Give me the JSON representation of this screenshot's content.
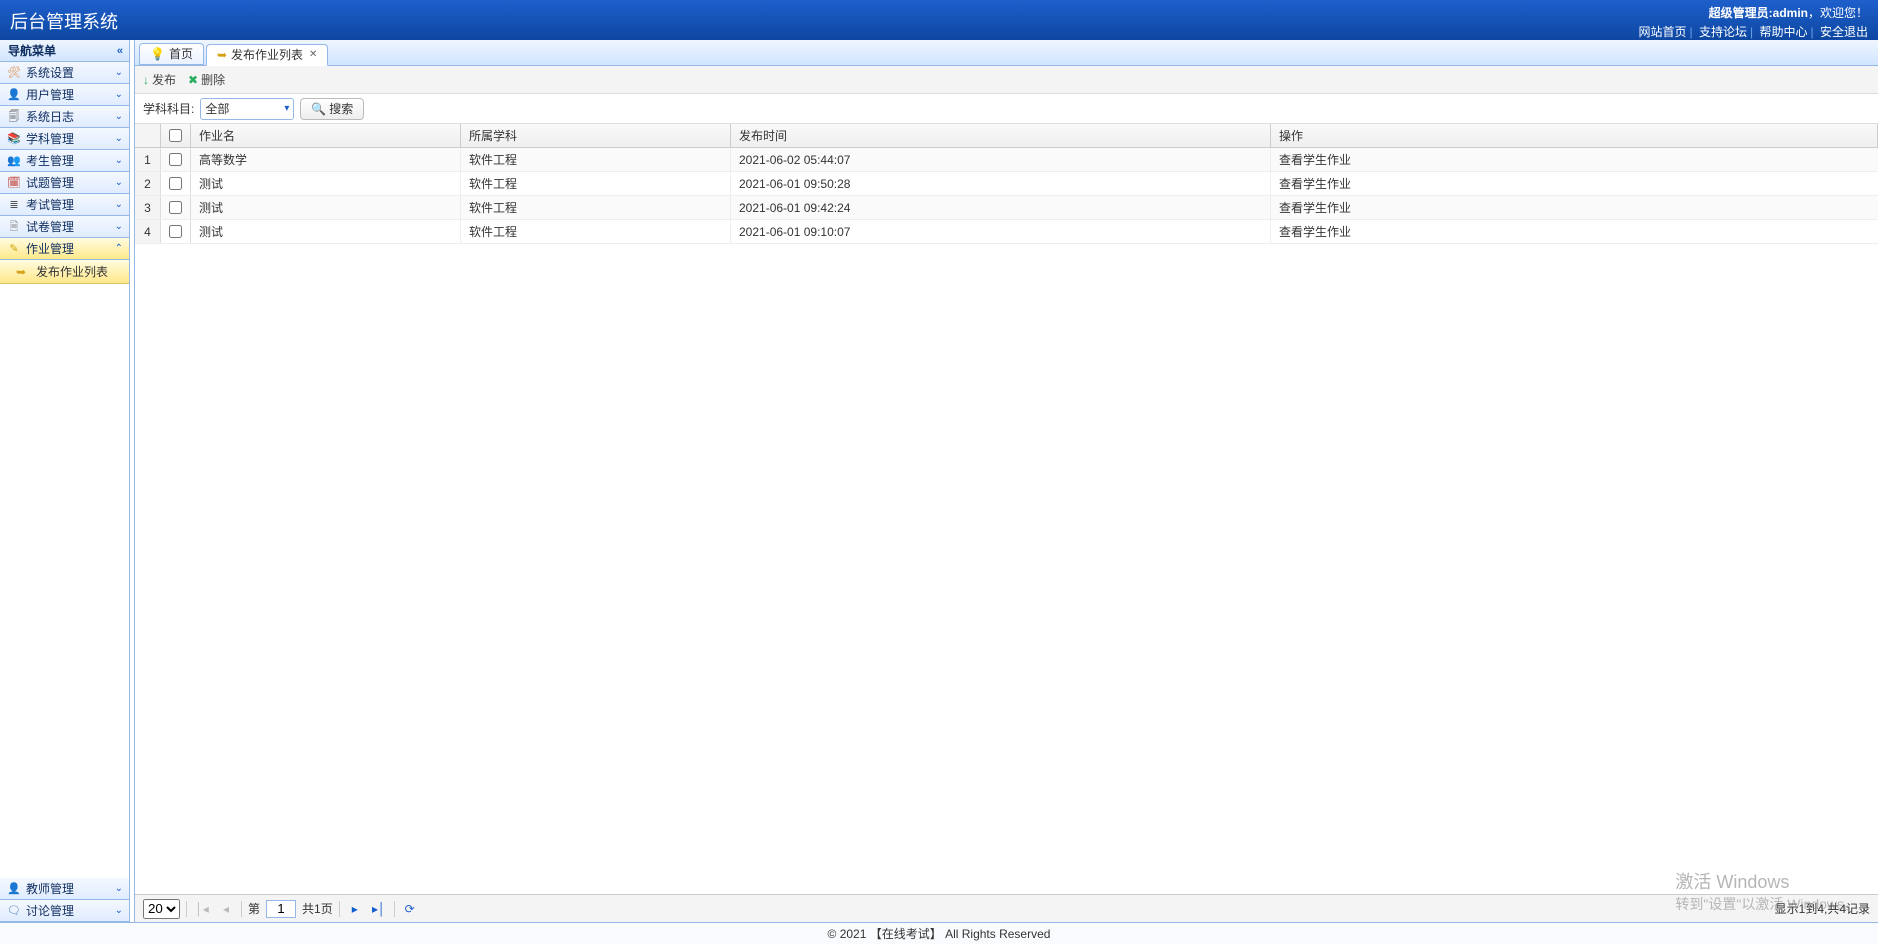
{
  "header": {
    "title": "后台管理系统",
    "welcome_prefix": "超级管理员:",
    "admin_name": "admin",
    "welcome_suffix": "，欢迎您！",
    "links": {
      "home": "网站首页",
      "forum": "支持论坛",
      "help": "帮助中心",
      "logout": "安全退出"
    }
  },
  "sidebar": {
    "title": "导航菜单",
    "items": [
      {
        "label": "系统设置",
        "icon": "🛠",
        "cls": "ic-tools"
      },
      {
        "label": "用户管理",
        "icon": "👤",
        "cls": "ic-user"
      },
      {
        "label": "系统日志",
        "icon": "🗐",
        "cls": "ic-log"
      },
      {
        "label": "学科管理",
        "icon": "📚",
        "cls": "ic-subject"
      },
      {
        "label": "考生管理",
        "icon": "👥",
        "cls": "ic-student"
      },
      {
        "label": "试题管理",
        "icon": "🗓",
        "cls": "ic-question"
      },
      {
        "label": "考试管理",
        "icon": "≣",
        "cls": "ic-exam"
      },
      {
        "label": "试卷管理",
        "icon": "🗎",
        "cls": "ic-paper"
      }
    ],
    "active": {
      "label": "作业管理",
      "icon": "✎",
      "cls": "ic-homework"
    },
    "active_sub": {
      "label": "发布作业列表",
      "icon": "➥",
      "cls": "ic-publish"
    },
    "bottom": [
      {
        "label": "教师管理",
        "icon": "👤",
        "cls": "ic-teacher"
      },
      {
        "label": "讨论管理",
        "icon": "🗨",
        "cls": "ic-discuss"
      }
    ]
  },
  "tabs": {
    "home": "首页",
    "publish_list": "发布作业列表"
  },
  "toolbar": {
    "publish": "发布",
    "delete": "删除"
  },
  "filter": {
    "label": "学科科目:",
    "value": "全部",
    "search": "搜索"
  },
  "grid": {
    "headers": {
      "name": "作业名",
      "subject": "所属学科",
      "time": "发布时间",
      "action": "操作"
    },
    "action_label": "查看学生作业",
    "rows": [
      {
        "num": "1",
        "name": "高等数学",
        "subject": "软件工程",
        "time": "2021-06-02 05:44:07"
      },
      {
        "num": "2",
        "name": "测试",
        "subject": "软件工程",
        "time": "2021-06-01 09:50:28"
      },
      {
        "num": "3",
        "name": "测试",
        "subject": "软件工程",
        "time": "2021-06-01 09:42:24"
      },
      {
        "num": "4",
        "name": "测试",
        "subject": "软件工程",
        "time": "2021-06-01 09:10:07"
      }
    ]
  },
  "pager": {
    "page_size": "20",
    "page_label_prefix": "第",
    "page_value": "1",
    "page_label_suffix": "共1页",
    "info": "显示1到4,共4记录"
  },
  "footer": {
    "text": "© 2021 【在线考试】 All Rights Reserved"
  },
  "watermark": {
    "line1": "激活 Windows",
    "line2": "转到\"设置\"以激活 Windows。"
  }
}
